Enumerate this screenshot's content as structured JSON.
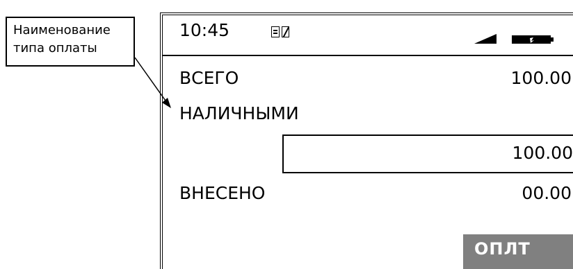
{
  "callout": {
    "line1": "Наименование",
    "line2": "типа оплаты"
  },
  "status_bar": {
    "time": "10:45",
    "icons": [
      "document-icon",
      "fiscal-drive-icon",
      "signal-strength-icon",
      "battery-icon"
    ]
  },
  "rows": {
    "total_label": "ВСЕГО",
    "total_value": "100.00",
    "payment_type": "НАЛИЧНЫМИ",
    "entered_amount": "100.00",
    "deposited_label": "ВНЕСЕНО",
    "deposited_value": "00.00"
  },
  "softkey": {
    "pay_label": "ОПЛТ"
  },
  "colors": {
    "softkey_background": "#808080",
    "softkey_text": "#ffffff",
    "foreground": "#000000",
    "background": "#ffffff"
  }
}
